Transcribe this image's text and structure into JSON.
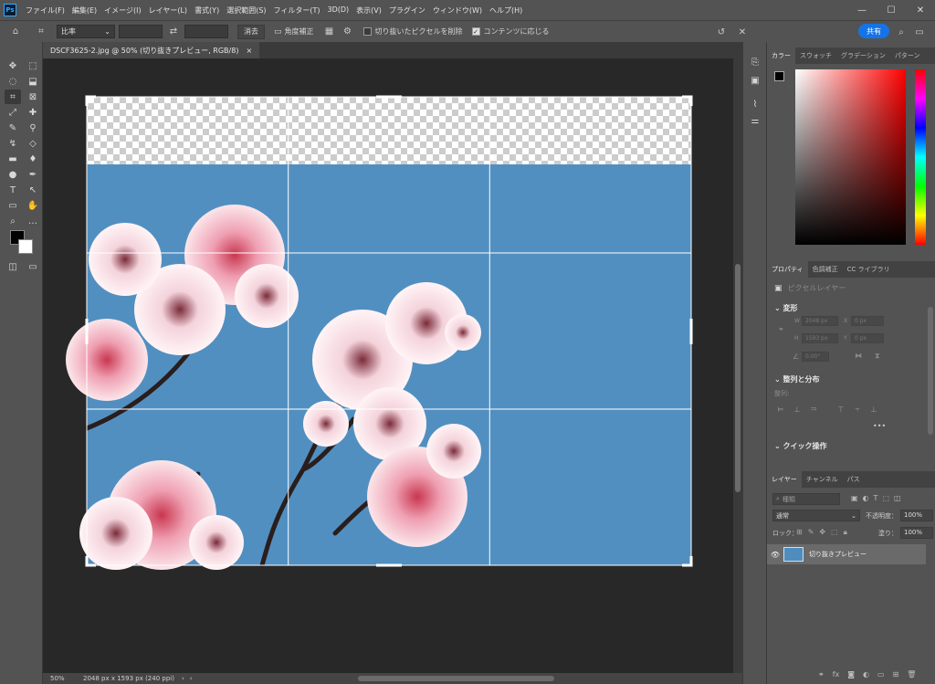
{
  "app": {
    "logo": "Ps"
  },
  "menu": [
    "ファイル(F)",
    "編集(E)",
    "イメージ(I)",
    "レイヤー(L)",
    "書式(Y)",
    "選択範囲(S)",
    "フィルター(T)",
    "3D(D)",
    "表示(V)",
    "プラグイン",
    "ウィンドウ(W)",
    "ヘルプ(H)"
  ],
  "window_controls": {
    "minimize": "—",
    "maximize": "☐",
    "close": "✕"
  },
  "options": {
    "ratio_label": "比率",
    "ratio_w": "",
    "ratio_h": "",
    "clear": "消去",
    "straighten": "角度補正",
    "delete_cropped": "切り抜いたピクセルを削除",
    "delete_cropped_checked": false,
    "content_aware": "コンテンツに応じる",
    "content_aware_checked": true,
    "share": "共有"
  },
  "document": {
    "tab_title": "DSCF3625-2.jpg @ 50% (切り抜きプレビュー, RGB/8)",
    "tab_close": "×",
    "zoom": "50%",
    "doc_info": "2048 px x 1593 px (240 ppi)"
  },
  "color_panel": {
    "tabs": [
      "カラー",
      "スウォッチ",
      "グラデーション",
      "パターン"
    ],
    "active": 0,
    "fg": "#000000",
    "bg": "#ffffff",
    "hue": "#ff0000"
  },
  "properties_panel": {
    "tabs": [
      "プロパティ",
      "色調補正",
      "CC ライブラリ"
    ],
    "active": 0,
    "layer_type": "ピクセルレイヤー",
    "transform_title": "変形",
    "w_label": "W",
    "w_value": "2048 px",
    "x_label": "X",
    "x_value": "0 px",
    "h_label": "H",
    "h_value": "1593 px",
    "y_label": "Y",
    "y_value": "0 px",
    "angle_value": "0.00°",
    "align_title": "整列と分布",
    "align_sub": "整列:",
    "more": "•••",
    "quick_title": "クイック操作"
  },
  "layers_panel": {
    "tabs": [
      "レイヤー",
      "チャンネル",
      "パス"
    ],
    "active": 0,
    "search_placeholder": "種類",
    "blend_mode": "通常",
    "opacity_label": "不透明度：",
    "opacity_value": "100%",
    "lock_label": "ロック：",
    "fill_label": "塗り：",
    "fill_value": "100%",
    "layers": [
      {
        "name": "切り抜きプレビュー",
        "visible": true
      }
    ]
  },
  "colors": {
    "accent": "#1473e6",
    "sky": "#4f8dbf",
    "grid": "#ffffff"
  }
}
